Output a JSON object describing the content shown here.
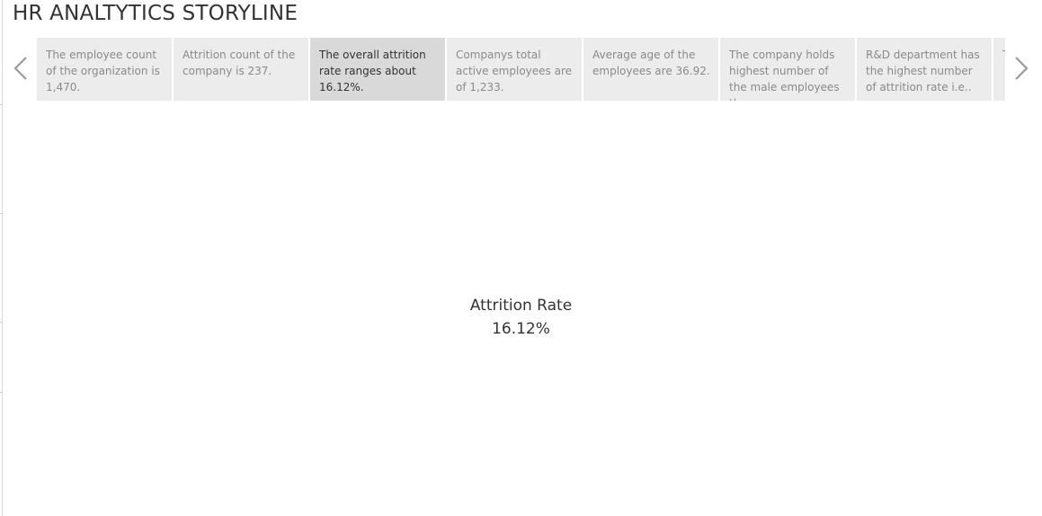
{
  "story": {
    "title": "HR ANALTYTICS STORYLINE"
  },
  "navigator": {
    "prev_icon": "chevron-left-icon",
    "next_icon": "chevron-right-icon",
    "points": [
      {
        "caption": "The employee count of the organization is 1,470."
      },
      {
        "caption": "Attrition count of the company is 237."
      },
      {
        "caption": "The overall attrition rate ranges about 16.12%."
      },
      {
        "caption": "Companys total active employees are of 1,233."
      },
      {
        "caption": "Average age of the employees are 36.92."
      },
      {
        "caption": "The company holds highest number of the male employees than"
      },
      {
        "caption": "R&D department has the highest number of attrition rate i.e.."
      },
      {
        "caption": "T e e"
      }
    ],
    "active_index": 2
  },
  "kpi": {
    "label": "Attrition Rate",
    "value": "16.12%"
  },
  "colors": {
    "point_bg": "#ececec",
    "point_active_bg": "#d9d9d9",
    "text_dark": "#333333",
    "text_muted": "#8a8a8a",
    "arrow": "#9a9a9a"
  }
}
